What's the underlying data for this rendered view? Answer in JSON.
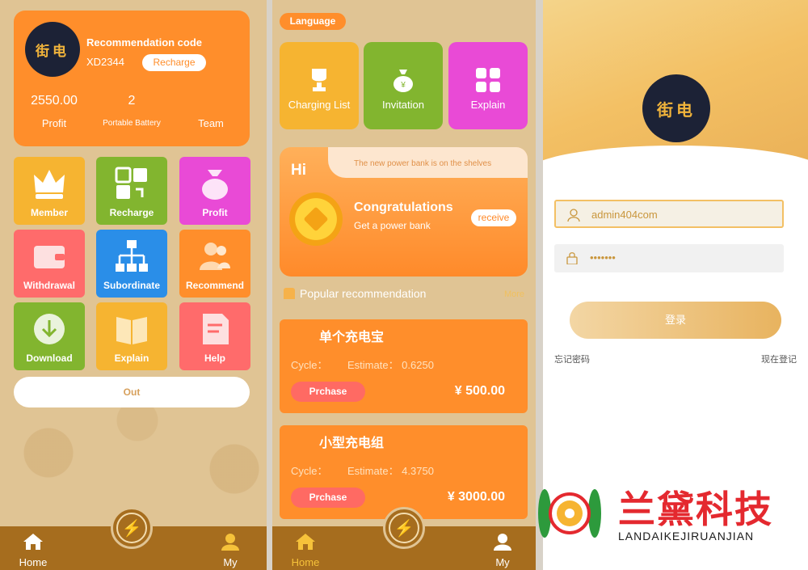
{
  "home_screen": {
    "logo_text": "街电",
    "recommendation_title": "Recommendation code",
    "recommendation_code": "XD2344",
    "recharge_label": "Recharge",
    "stats": [
      {
        "value": "2550.00",
        "label": "Profit"
      },
      {
        "value": "2",
        "label": "Portable Battery"
      },
      {
        "value": "",
        "label": "Team"
      }
    ],
    "tiles": [
      {
        "label": "Member",
        "color": "#f6b431",
        "icon": "crown-icon"
      },
      {
        "label": "Recharge",
        "color": "#82b52f",
        "icon": "exchange-icon"
      },
      {
        "label": "Profit",
        "color": "#e94ad6",
        "icon": "money-bag-icon"
      },
      {
        "label": "Withdrawal",
        "color": "#ff6b6b",
        "icon": "wallet-icon"
      },
      {
        "label": "Subordinate",
        "color": "#2a8ee8",
        "icon": "org-chart-icon"
      },
      {
        "label": "Recommend",
        "color": "#ff8e2b",
        "icon": "users-icon"
      },
      {
        "label": "Download",
        "color": "#82b52f",
        "icon": "download-icon"
      },
      {
        "label": "Explain",
        "color": "#f6b431",
        "icon": "book-icon"
      },
      {
        "label": "Help",
        "color": "#ff6b6b",
        "icon": "document-icon"
      }
    ],
    "out_label": "Out",
    "nav": {
      "home": "Home",
      "my": "My"
    }
  },
  "market_screen": {
    "language_label": "Language",
    "tiles": [
      {
        "label": "Charging List",
        "color": "#f6b431",
        "icon": "trophy-icon"
      },
      {
        "label": "Invitation",
        "color": "#82b52f",
        "icon": "money-bag-icon"
      },
      {
        "label": "Explain",
        "color": "#e94ad6",
        "icon": "grid-icon"
      }
    ],
    "banner": {
      "greeting": "Hi",
      "news": "The new power bank is on the shelves",
      "title": "Congratulations",
      "subtitle": "Get a power bank",
      "receive_label": "receive"
    },
    "popular_title": "Popular recommendation",
    "more_label": "More",
    "products": [
      {
        "name": "单个充电宝",
        "cycle_label": "Cycle：",
        "estimate": "Estimate： 0.6250",
        "buy_label": "Prchase",
        "price": "¥ 500.00"
      },
      {
        "name": "小型充电组",
        "cycle_label": "Cycle：",
        "estimate": "Estimate： 4.3750",
        "buy_label": "Prchase",
        "price": "¥ 3000.00"
      }
    ],
    "nav": {
      "home": "Home",
      "my": "My"
    }
  },
  "login_screen": {
    "logo_text": "街电",
    "username_value": "admin404com",
    "password_value": "•••••••",
    "login_label": "登录",
    "forgot_label": "忘记密码",
    "register_label": "现在登记"
  },
  "watermark": {
    "cn_text": "兰黛科技",
    "en_text": "LANDAIKEJIRUANJIAN"
  }
}
